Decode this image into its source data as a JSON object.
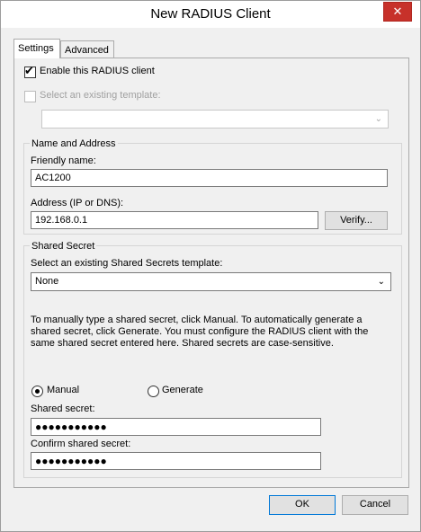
{
  "window": {
    "title": "New RADIUS Client",
    "close_glyph": "✕"
  },
  "tabs": [
    {
      "label": "Settings",
      "active": true
    },
    {
      "label": "Advanced",
      "active": false
    }
  ],
  "settings": {
    "enable_client": {
      "label": "Enable this RADIUS client",
      "checked": true
    },
    "existing_template": {
      "label": "Select an existing template:",
      "checked": false,
      "enabled": false,
      "value": ""
    },
    "name_address": {
      "group_title": "Name and Address",
      "friendly_name_label": "Friendly name:",
      "friendly_name_value": "AC1200",
      "address_label": "Address (IP or DNS):",
      "address_value": "192.168.0.1",
      "verify_label": "Verify..."
    },
    "shared_secret": {
      "group_title": "Shared Secret",
      "template_label": "Select an existing Shared Secrets template:",
      "template_value": "None",
      "description": "To manually type a shared secret, click Manual. To automatically generate a shared secret, click Generate. You must configure the RADIUS client with the same shared secret entered here. Shared secrets are case-sensitive.",
      "manual_label": "Manual",
      "generate_label": "Generate",
      "selected_mode": "manual",
      "secret_label": "Shared secret:",
      "secret_value": "●●●●●●●●●●●",
      "confirm_label": "Confirm shared secret:",
      "confirm_value": "●●●●●●●●●●●"
    }
  },
  "footer": {
    "ok_label": "OK",
    "cancel_label": "Cancel"
  },
  "icons": {
    "checkmark": "✔",
    "chevron_down": "⌄"
  }
}
